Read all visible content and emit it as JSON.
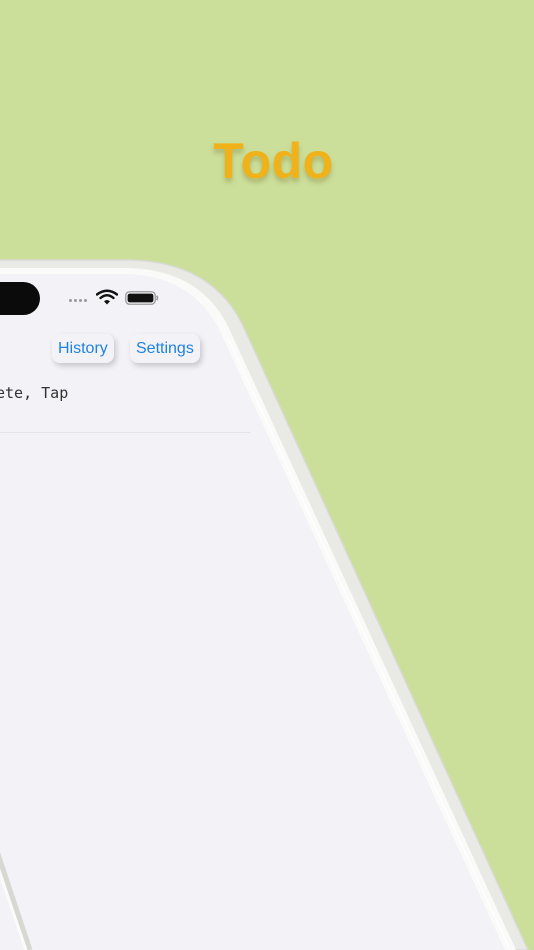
{
  "banner": {
    "title": "Todo"
  },
  "app": {
    "nav": {
      "history_label": "History",
      "settings_label": "Settings"
    },
    "hint_text": "ete, Tap"
  },
  "colors": {
    "background": "#cbdf9a",
    "title": "#efb21a",
    "accent": "#1f82e0",
    "screen": "#f2f2f7"
  },
  "status_bar": {
    "icons": [
      "cellular-signal-icon",
      "wifi-icon",
      "battery-icon"
    ]
  }
}
